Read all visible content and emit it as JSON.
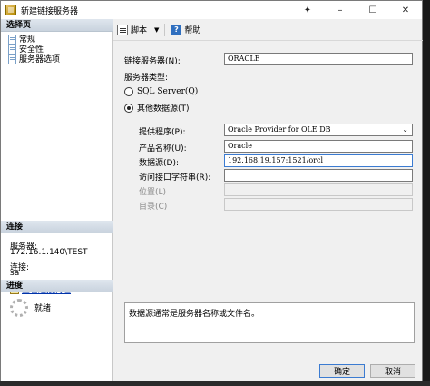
{
  "window": {
    "title": "新建链接服务器",
    "minimize": "–",
    "maximize": "☐",
    "close": "✕",
    "pin": "✦"
  },
  "left": {
    "pages_header": "选择页",
    "pages": [
      "常规",
      "安全性",
      "服务器选项"
    ],
    "connection_header": "连接",
    "server_label": "服务器:",
    "server_value": "172.16.1.140\\TEST",
    "connection_label": "连接:",
    "connection_value": "sa",
    "view_props_link": "查看连接属性",
    "progress_header": "进度",
    "progress_status": "就绪"
  },
  "toolbar": {
    "script_label": "脚本",
    "dropdown_glyph": "▼",
    "help_label": "帮助"
  },
  "form": {
    "linked_server_label": "链接服务器(N):",
    "linked_server_value": "ORACLE",
    "server_type_label": "服务器类型:",
    "sql_server_label": "SQL Server(Q)",
    "other_source_label": "其他数据源(T)",
    "provider_label": "提供程序(P):",
    "provider_value": "Oracle Provider for OLE DB",
    "product_label": "产品名称(U):",
    "product_value": "Oracle",
    "datasource_label": "数据源(D):",
    "datasource_value": "192.168.19.157:1521/orcl",
    "access_string_label": "访问接口字符串(R):",
    "access_string_value": "",
    "location_label": "位置(L)",
    "location_value": "",
    "catalog_label": "目录(C)",
    "catalog_value": ""
  },
  "description": "数据源通常是服务器名称或文件名。",
  "buttons": {
    "ok": "确定",
    "cancel": "取消"
  }
}
